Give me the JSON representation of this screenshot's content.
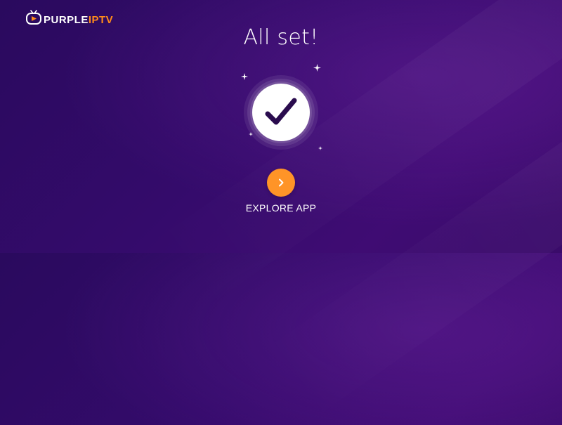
{
  "logo": {
    "brand_white": "PURPLE",
    "brand_orange": "IPTV",
    "icon": "tv-play-icon",
    "brand_orange_color": "#ff8c1a"
  },
  "main": {
    "title": "All set!",
    "status_icon": "checkmark-icon"
  },
  "action": {
    "label": "EXPLORE APP",
    "icon": "chevron-right-icon",
    "color": "#ff9427"
  },
  "colors": {
    "background_start": "#2a0a5e",
    "background_end": "#3f0c73",
    "check_color": "#2a0c4e"
  }
}
